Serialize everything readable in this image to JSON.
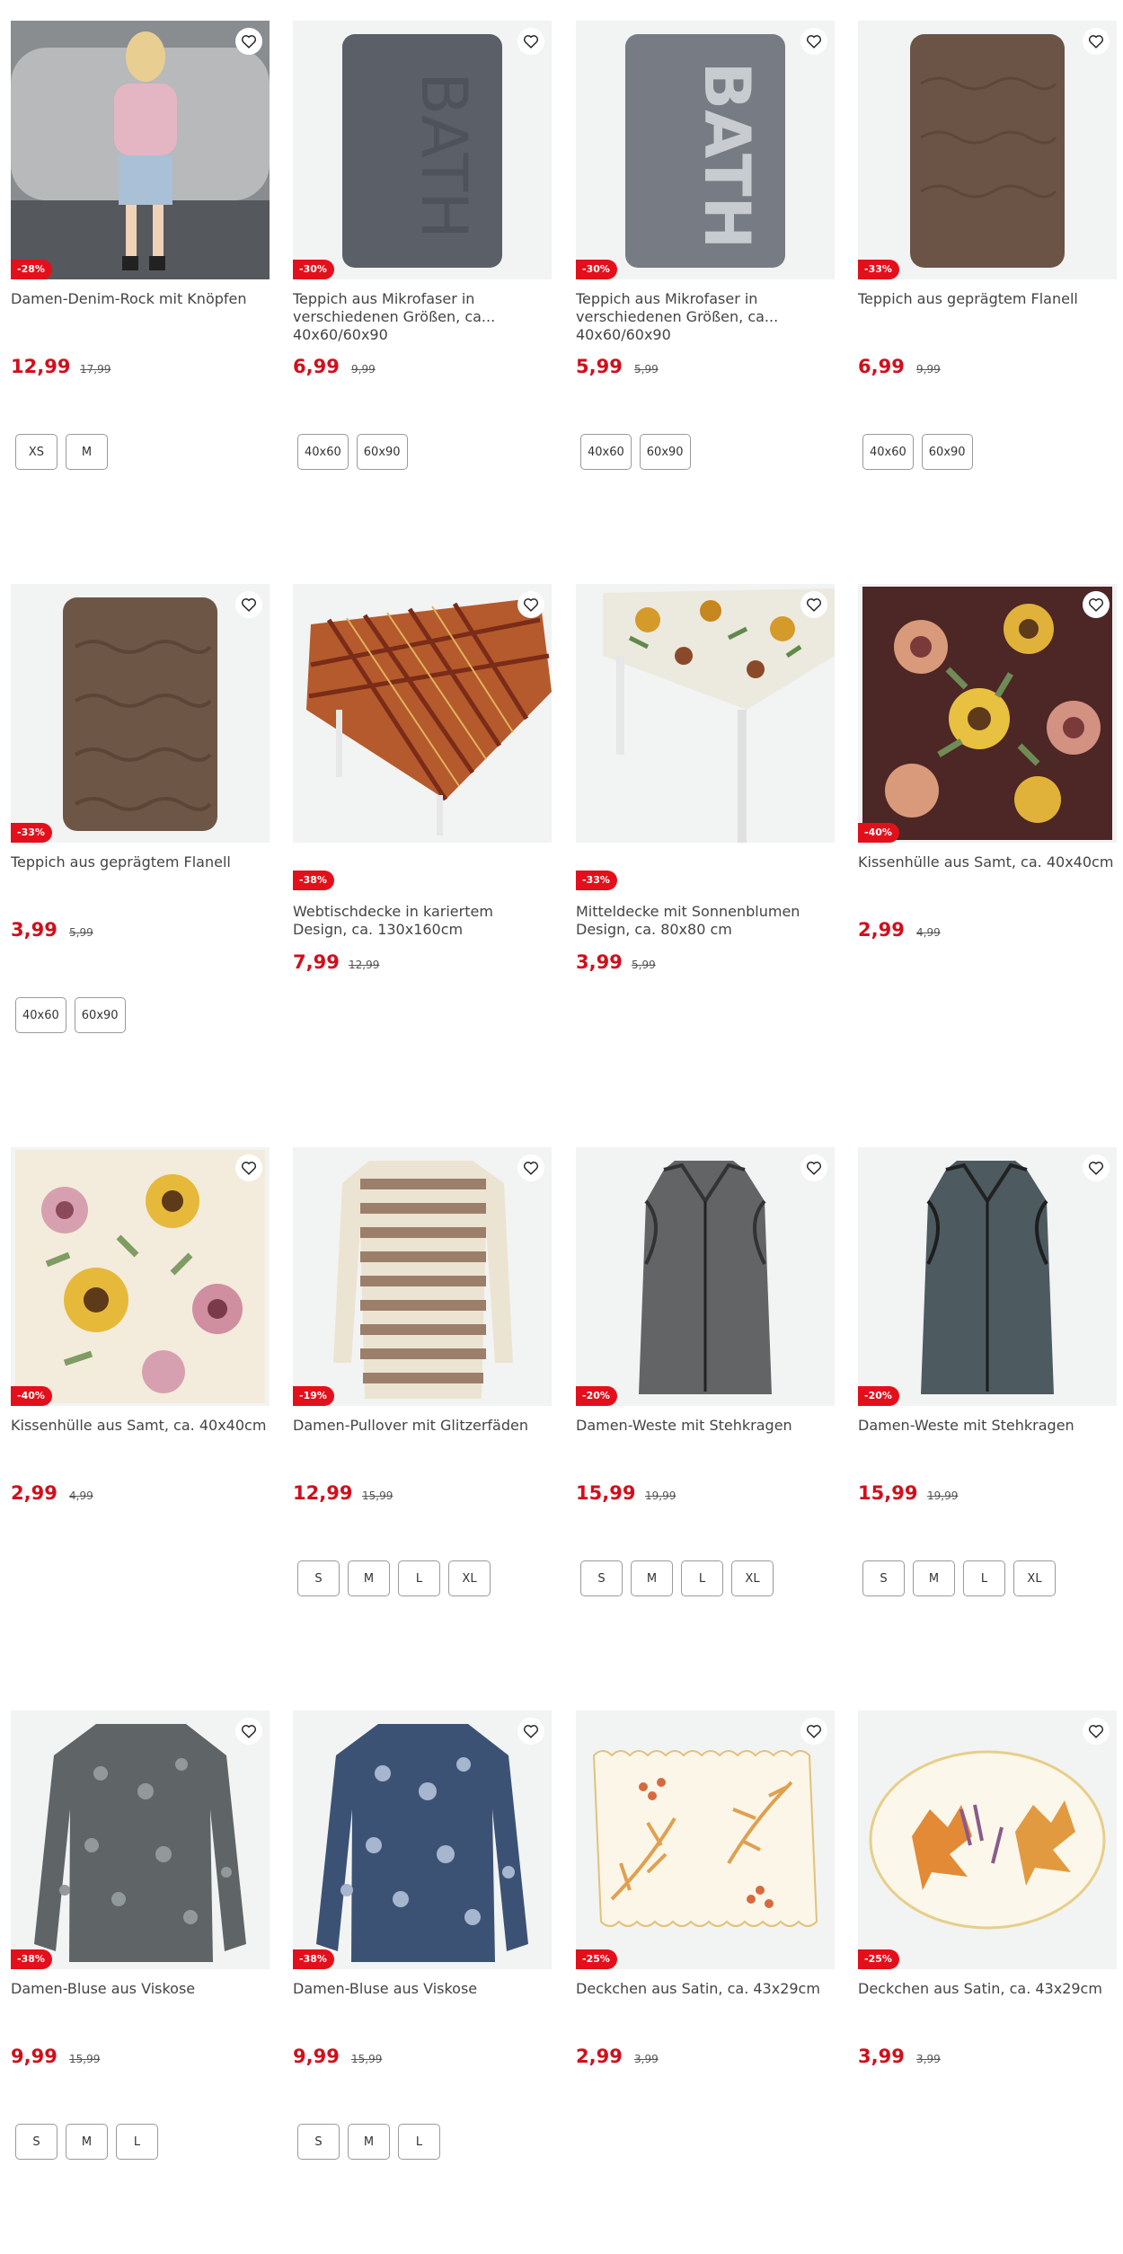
{
  "products": [
    {
      "title": "Damen-Denim-Rock mit Knöpfen",
      "discount": "-28%",
      "price": "12,99",
      "old_price": "17,99",
      "sizes": [
        "XS",
        "M"
      ]
    },
    {
      "title": "Teppich aus Mikrofaser in verschiedenen Größen, ca... 40x60/60x90",
      "discount": "-30%",
      "price": "6,99",
      "old_price": "9,99",
      "sizes": [
        "40x60",
        "60x90"
      ]
    },
    {
      "title": "Teppich aus Mikrofaser in verschiedenen Größen, ca... 40x60/60x90",
      "discount": "-30%",
      "price": "5,99",
      "old_price": "5,99",
      "sizes": [
        "40x60",
        "60x90"
      ]
    },
    {
      "title": "Teppich aus geprägtem Flanell",
      "discount": "-33%",
      "price": "6,99",
      "old_price": "9,99",
      "sizes": [
        "40x60",
        "60x90"
      ]
    },
    {
      "title": "Teppich aus geprägtem Flanell",
      "discount": "-33%",
      "price": "3,99",
      "old_price": "5,99",
      "sizes": [
        "40x60",
        "60x90"
      ]
    },
    {
      "title": "Webtischdecke in kariertem Design, ca. 130x160cm",
      "discount": "-38%",
      "price": "7,99",
      "old_price": "12,99",
      "sizes": []
    },
    {
      "title": "Mitteldecke mit Sonnenblumen Design, ca. 80x80 cm",
      "discount": "-33%",
      "price": "3,99",
      "old_price": "5,99",
      "sizes": []
    },
    {
      "title": "Kissenhülle aus Samt, ca. 40x40cm",
      "discount": "-40%",
      "price": "2,99",
      "old_price": "4,99",
      "sizes": []
    },
    {
      "title": "Kissenhülle aus Samt, ca. 40x40cm",
      "discount": "-40%",
      "price": "2,99",
      "old_price": "4,99",
      "sizes": []
    },
    {
      "title": "Damen-Pullover mit Glitzerfäden",
      "discount": "-19%",
      "price": "12,99",
      "old_price": "15,99",
      "sizes": [
        "S",
        "M",
        "L",
        "XL"
      ]
    },
    {
      "title": "Damen-Weste mit Stehkragen",
      "discount": "-20%",
      "price": "15,99",
      "old_price": "19,99",
      "sizes": [
        "S",
        "M",
        "L",
        "XL"
      ]
    },
    {
      "title": "Damen-Weste mit Stehkragen",
      "discount": "-20%",
      "price": "15,99",
      "old_price": "19,99",
      "sizes": [
        "S",
        "M",
        "L",
        "XL"
      ]
    },
    {
      "title": "Damen-Bluse aus Viskose",
      "discount": "-38%",
      "price": "9,99",
      "old_price": "15,99",
      "sizes": [
        "S",
        "M",
        "L"
      ]
    },
    {
      "title": "Damen-Bluse aus Viskose",
      "discount": "-38%",
      "price": "9,99",
      "old_price": "15,99",
      "sizes": [
        "S",
        "M",
        "L"
      ]
    },
    {
      "title": "Deckchen aus Satin, ca. 43x29cm",
      "discount": "-25%",
      "price": "2,99",
      "old_price": "3,99",
      "sizes": []
    },
    {
      "title": "Deckchen aus Satin, ca. 43x29cm",
      "discount": "-25%",
      "price": "3,99",
      "old_price": "3,99",
      "sizes": []
    }
  ],
  "icons": {
    "favorite": "heart-outline-icon"
  },
  "colors": {
    "accent": "#d10f1c",
    "badge": "#e3101b"
  }
}
